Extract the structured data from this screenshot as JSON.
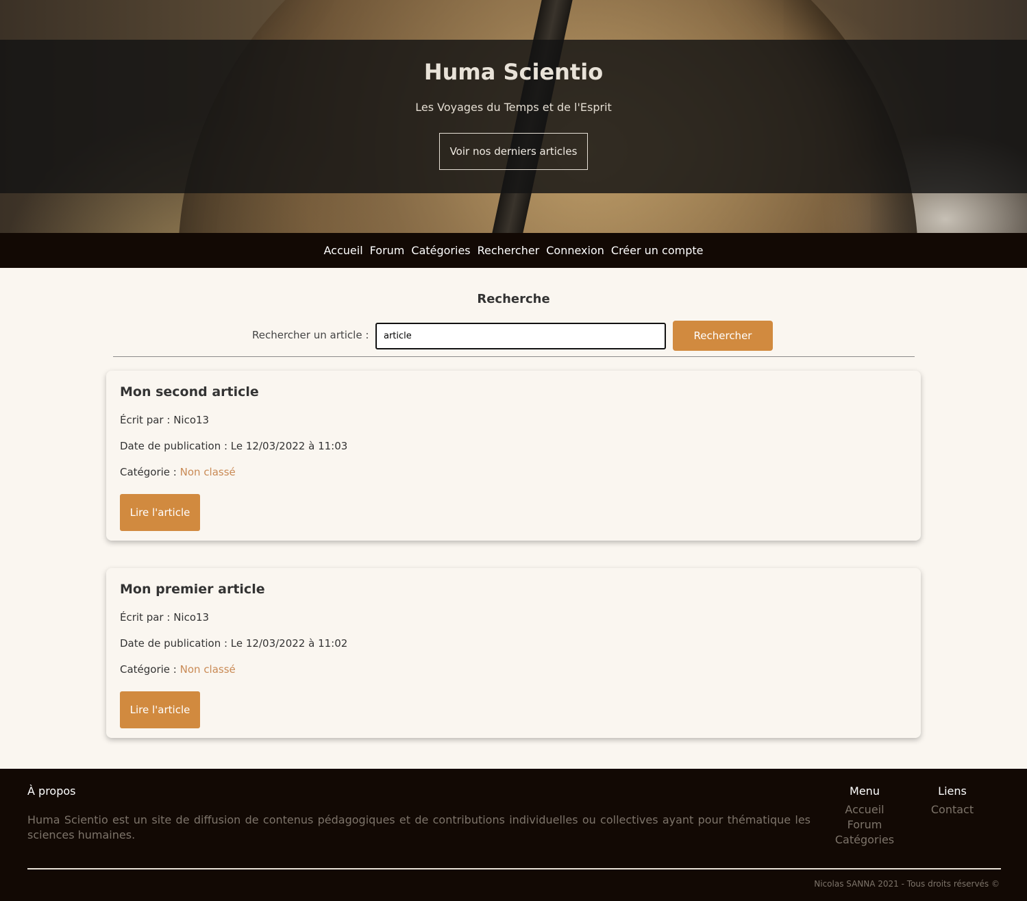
{
  "hero": {
    "title": "Huma Scientio",
    "subtitle": "Les Voyages du Temps et de l'Esprit",
    "button_label": "Voir nos derniers articles"
  },
  "nav": {
    "items": [
      {
        "label": "Accueil"
      },
      {
        "label": "Forum"
      },
      {
        "label": "Catégories"
      },
      {
        "label": "Rechercher"
      },
      {
        "label": "Connexion"
      },
      {
        "label": "Créer un compte"
      }
    ]
  },
  "search": {
    "title": "Recherche",
    "label": "Rechercher un article :",
    "value": "article",
    "button_label": "Rechercher"
  },
  "articles": [
    {
      "title": "Mon second article",
      "author_prefix": "Écrit par : ",
      "author": "Nico13",
      "date_prefix": "Date de publication : ",
      "date": "Le 12/03/2022 à 11:03",
      "category_prefix": "Catégorie : ",
      "category": "Non classé",
      "button_label": "Lire l'article"
    },
    {
      "title": "Mon premier article",
      "author_prefix": "Écrit par : ",
      "author": "Nico13",
      "date_prefix": "Date de publication : ",
      "date": "Le 12/03/2022 à 11:02",
      "category_prefix": "Catégorie : ",
      "category": "Non classé",
      "button_label": "Lire l'article"
    }
  ],
  "footer": {
    "about_title": "À propos",
    "about_text": "Huma Scientio est un site de diffusion de contenus pédagogiques et de contributions individuelles ou collectives ayant pour thématique les sciences humaines.",
    "menu_title": "Menu",
    "menu_items": [
      {
        "label": "Accueil"
      },
      {
        "label": "Forum"
      },
      {
        "label": "Catégories"
      }
    ],
    "links_title": "Liens",
    "links_items": [
      {
        "label": "Contact"
      }
    ],
    "copyright": "Nicolas SANNA 2021 - Tous droits réservés ©"
  },
  "colors": {
    "accent": "#d18a3f",
    "nav_bg": "#120904",
    "page_bg": "#faf6f0",
    "category_link": "#c98a55"
  }
}
